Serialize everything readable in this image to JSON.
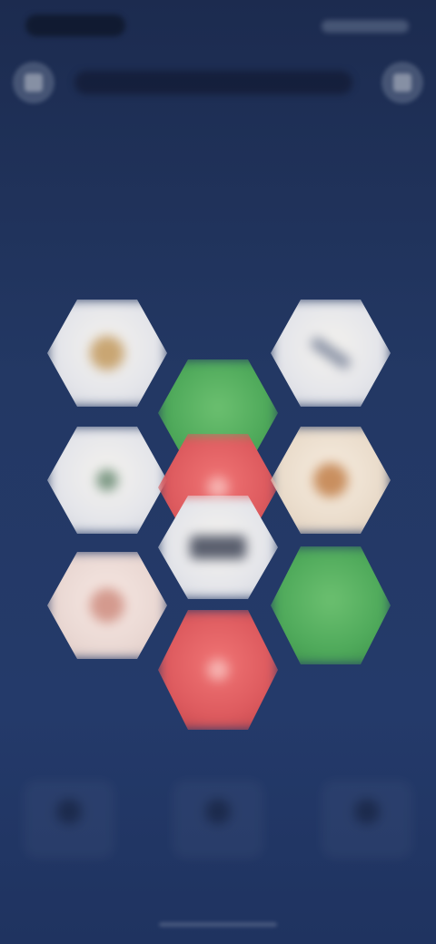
{
  "screen": {
    "background_top": "#1c2b4f",
    "background_bottom": "#243a6a"
  },
  "colors": {
    "tile_white": "#e4e5ea",
    "tile_cream": "#eadccb",
    "tile_blush": "#ead8d3",
    "tile_green": "#4ea95a",
    "tile_red": "#dd5a5e"
  },
  "top_bar": {
    "back_icon": "back-icon",
    "menu_icon": "menu-icon"
  },
  "board": {
    "tiles": [
      {
        "id": "r1-left",
        "color": "white",
        "icon": "bell-icon"
      },
      {
        "id": "r1-right",
        "color": "white",
        "icon": "pencil-icon"
      },
      {
        "id": "r1-center",
        "color": "green",
        "icon": ""
      },
      {
        "id": "r2-left",
        "color": "white",
        "icon": "leaf-icon"
      },
      {
        "id": "r2-center",
        "color": "red",
        "icon": "drop-icon"
      },
      {
        "id": "r2-right",
        "color": "cream",
        "icon": "cookie-icon"
      },
      {
        "id": "r3-center",
        "color": "white",
        "icon": "box-icon"
      },
      {
        "id": "r3-left",
        "color": "blush",
        "icon": "heart-icon"
      },
      {
        "id": "r3-right",
        "color": "green",
        "icon": ""
      },
      {
        "id": "r4-center",
        "color": "red",
        "icon": "drop-icon"
      }
    ]
  },
  "bottom_bar": {
    "items": [
      {
        "icon": "tool-icon"
      },
      {
        "icon": "tool-icon"
      },
      {
        "icon": "tool-icon"
      }
    ]
  }
}
